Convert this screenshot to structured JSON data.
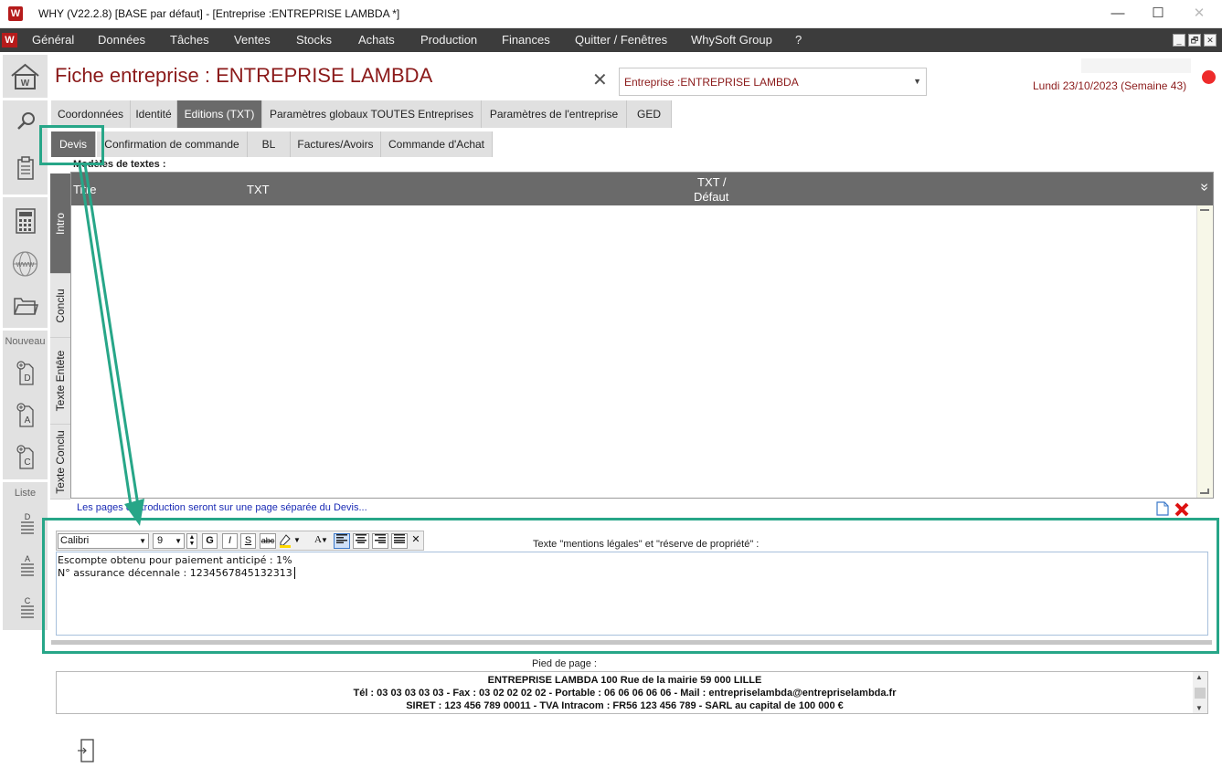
{
  "window": {
    "app_logo": "W",
    "title": "WHY (V22.2.8)  [BASE par défaut] - [Entreprise :ENTREPRISE LAMBDA *]",
    "minimize": "—",
    "maximize": "☐",
    "close": "✕"
  },
  "menubar": {
    "logo": "W",
    "items": [
      "Général",
      "Données",
      "Tâches",
      "Ventes",
      "Stocks",
      "Achats",
      "Production",
      "Finances",
      "Quitter / Fenêtres",
      "WhySoft Group",
      "?"
    ],
    "mdi": [
      "_",
      "🗗",
      "✕"
    ]
  },
  "sidebar": {
    "nouveau_label": "Nouveau",
    "liste_label": "Liste",
    "new_letters": [
      "D",
      "A",
      "C"
    ],
    "list_letters": [
      "D",
      "A",
      "C"
    ]
  },
  "header": {
    "page_title": "Fiche entreprise : ENTREPRISE LAMBDA",
    "close": "✕",
    "entity_value": "Entreprise :ENTREPRISE LAMBDA",
    "date": "Lundi 23/10/2023 (Semaine 43)"
  },
  "tabs": [
    "Coordonnées",
    "Identité",
    "Editions (TXT)",
    "Paramètres globaux TOUTES Entreprises",
    "Paramètres de l'entreprise",
    "GED"
  ],
  "subtabs": [
    "Devis",
    "Confirmation de commande",
    "BL",
    "Factures/Avoirs",
    "Commande d'Achat"
  ],
  "vtabs": [
    "Intro",
    "Conclu",
    "Texte Entête",
    "Texte Conclu"
  ],
  "grid": {
    "label": "Modèles de textes :",
    "col_title": "Titre",
    "col_txt": "TXT",
    "col_default_1": "TXT /",
    "col_default_2": "Défaut",
    "expand": "»"
  },
  "info_text": "Les pages d'introduction seront sur une page séparée du Devis...",
  "editor": {
    "font": "Calibri",
    "size": "9",
    "bold": "G",
    "italic": "I",
    "underline": "S",
    "strike": "abc",
    "font_color": "A",
    "clear": "✕",
    "label": "Texte \"mentions légales\" et \"réserve de propriété\" :",
    "lines": [
      "Escompte obtenu pour paiement anticipé : 1%",
      "N° assurance décennale : 1234567845132313"
    ]
  },
  "footer": {
    "label": "Pied de page :",
    "lines": [
      "ENTREPRISE LAMBDA 100 Rue de la mairie 59 000 LILLE",
      "Tél : 03 03 03 03 03  - Fax : 03 02 02 02 02 - Portable : 06 06 06 06 06 - Mail : entrepriselambda@entrepriselambda.fr",
      "SIRET : 123 456 789 00011 - TVA Intracom : FR56 123 456 789 - SARL au capital de 100 000 €"
    ]
  },
  "colors": {
    "accent_red": "#8b1a1a",
    "menubar_bg": "#3c3c3c",
    "active_tab": "#6a6a6a",
    "highlight_green": "#27a688"
  }
}
